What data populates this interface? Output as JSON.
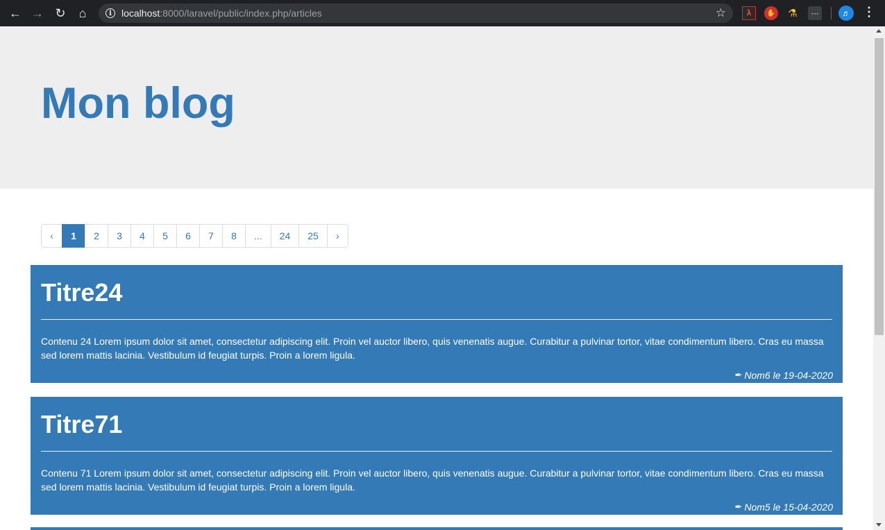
{
  "browser": {
    "url_host": "localhost",
    "url_rest": ":8000/laravel/public/index.php/articles"
  },
  "site": {
    "title": "Mon blog"
  },
  "pagination": {
    "prev": "‹",
    "next": "›",
    "pages": [
      "1",
      "2",
      "3",
      "4",
      "5",
      "6",
      "7",
      "8",
      "...",
      "24",
      "25"
    ],
    "active": "1"
  },
  "articles": [
    {
      "title": "Titre24",
      "body": "Contenu 24 Lorem ipsum dolor sit amet, consectetur adipiscing elit. Proin vel auctor libero, quis venenatis augue. Curabitur a pulvinar tortor, vitae condimentum libero. Cras eu massa sed lorem mattis lacinia. Vestibulum id feugiat turpis. Proin a lorem ligula.",
      "meta": "Nom6 le 19-04-2020"
    },
    {
      "title": "Titre71",
      "body": "Contenu 71 Lorem ipsum dolor sit amet, consectetur adipiscing elit. Proin vel auctor libero, quis venenatis augue. Curabitur a pulvinar tortor, vitae condimentum libero. Cras eu massa sed lorem mattis lacinia. Vestibulum id feugiat turpis. Proin a lorem ligula.",
      "meta": "Nom5 le 15-04-2020"
    }
  ],
  "icons": {
    "back": "back-arrow-icon",
    "forward": "forward-arrow-icon",
    "reload": "reload-icon",
    "home": "home-icon",
    "info": "info-icon",
    "star": "star-icon",
    "pen": "pen-icon"
  },
  "colors": {
    "primary": "#337ab7",
    "jumbotron": "#eeeeee",
    "chrome": "#202124"
  }
}
